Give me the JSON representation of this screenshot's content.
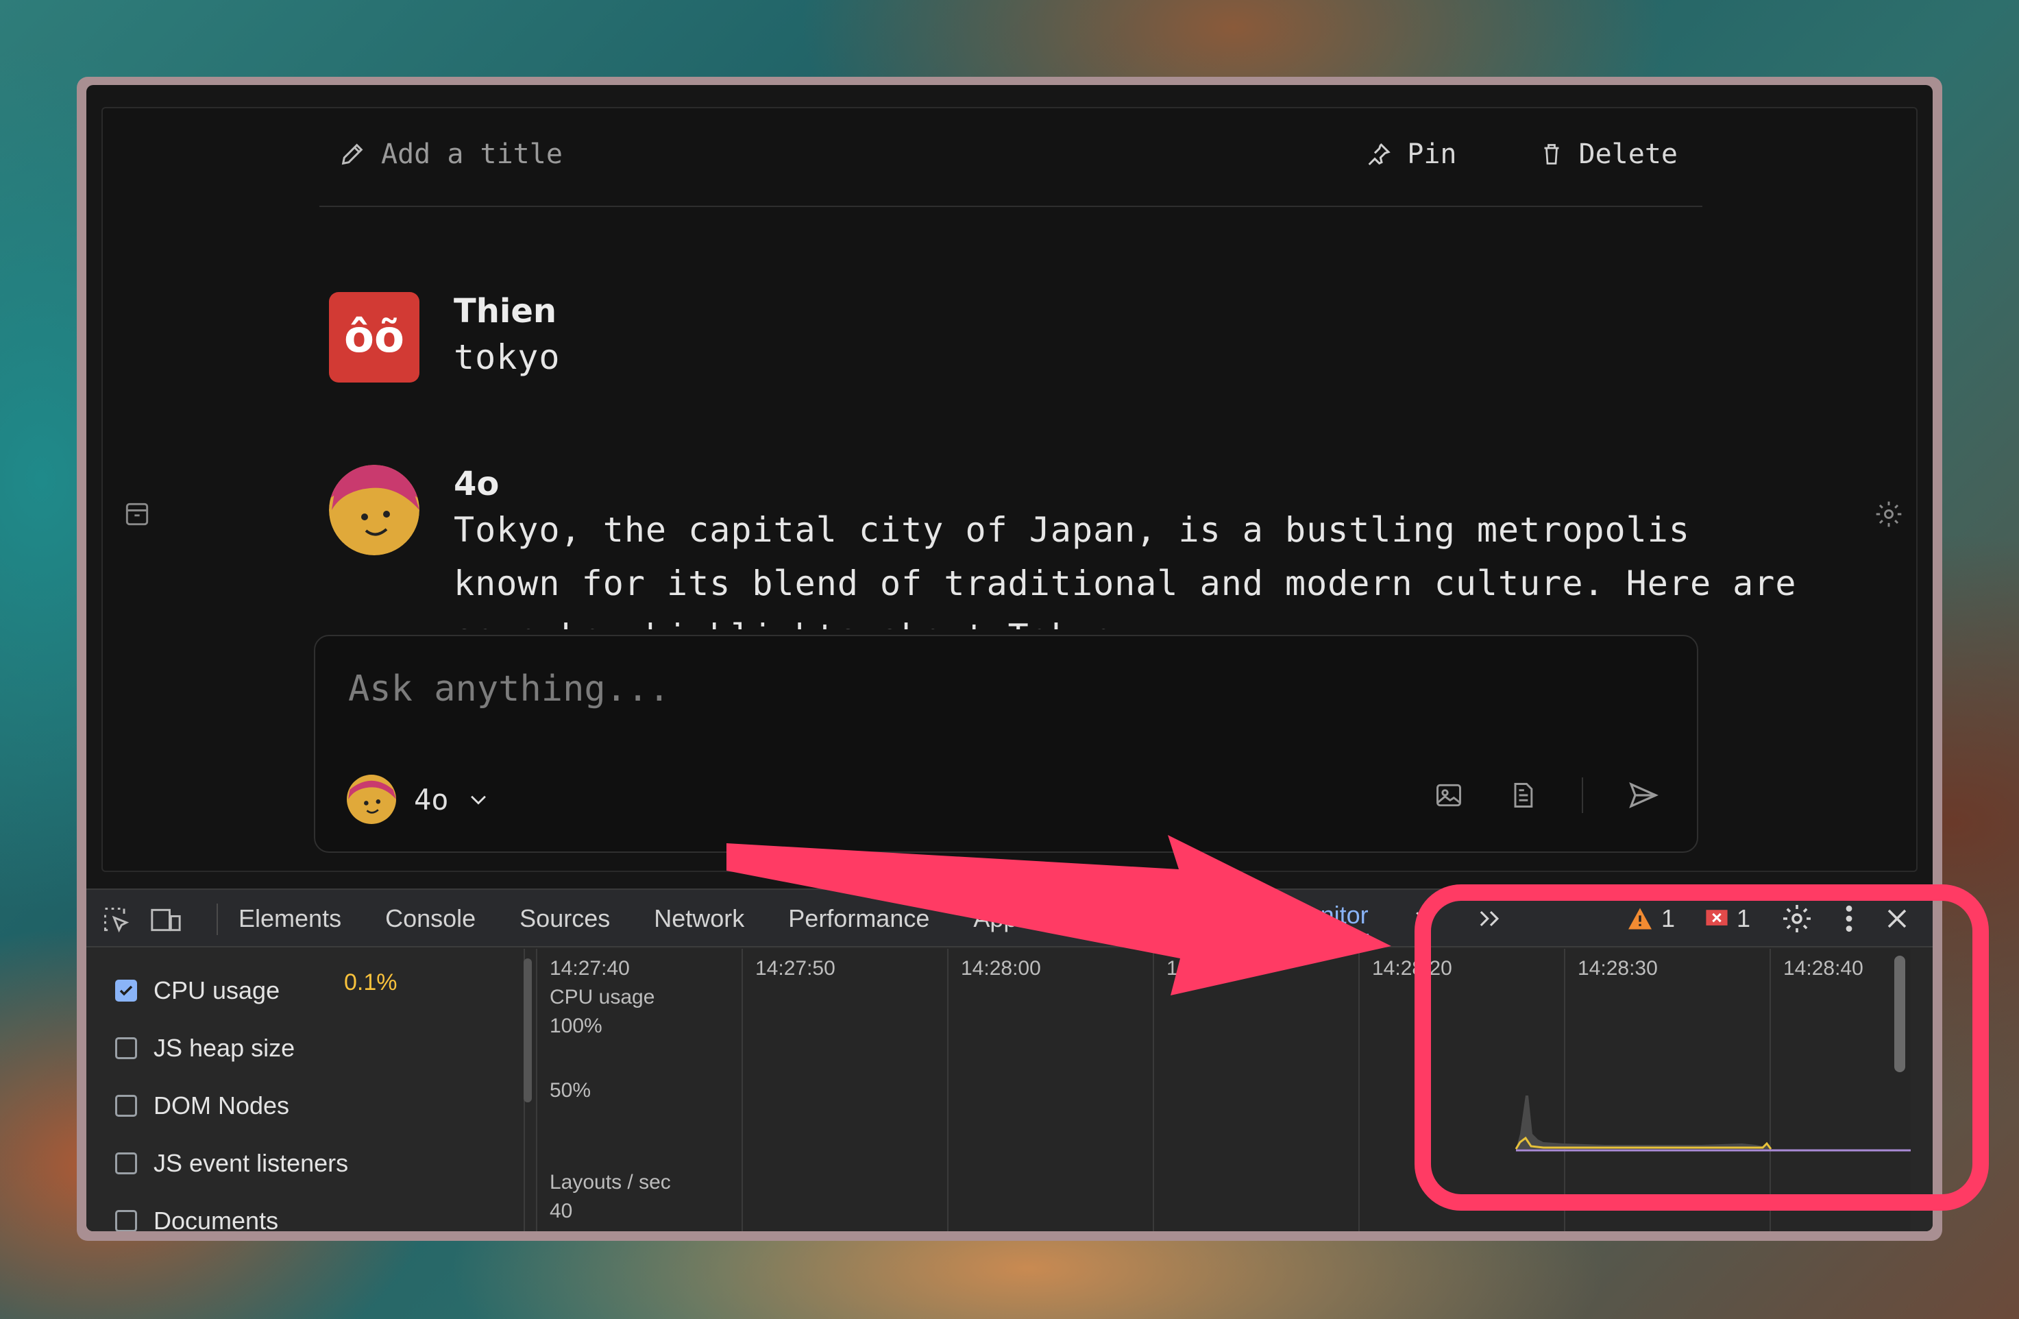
{
  "titlebar": {
    "add_title": "Add a title",
    "pin": "Pin",
    "delete": "Delete"
  },
  "messages": [
    {
      "name": "Thien",
      "avatar_text": "ôõ",
      "text": "tokyo"
    },
    {
      "name": "4o",
      "text_lines": [
        "Tokyo, the capital city of Japan, is a bustling metropolis",
        "known for its blend of traditional and modern culture. Here are",
        "some key highlights about Tokyo:"
      ]
    }
  ],
  "composer": {
    "placeholder": "Ask anything...",
    "model": "4o"
  },
  "devtools": {
    "tabs": [
      "Elements",
      "Console",
      "Sources",
      "Network",
      "Performance",
      "Application",
      "Performance monitor"
    ],
    "active_tab": "Performance monitor",
    "warnings": "1",
    "errors": "1",
    "metrics": [
      {
        "label": "CPU usage",
        "checked": true,
        "value": "0.1%"
      },
      {
        "label": "JS heap size",
        "checked": false
      },
      {
        "label": "DOM Nodes",
        "checked": false
      },
      {
        "label": "JS event listeners",
        "checked": false
      },
      {
        "label": "Documents",
        "checked": false
      }
    ],
    "times": [
      "14:27:40",
      "14:27:50",
      "14:28:00",
      "14:28:10",
      "14:28:20",
      "14:28:30",
      "14:28:40"
    ],
    "graph_cpu_label": "CPU usage",
    "graph_100": "100%",
    "graph_50": "50%",
    "graph_layouts_label": "Layouts / sec",
    "graph_layouts_value": "40"
  },
  "colors": {
    "annotation": "#ff3b64",
    "accent": "#8ab4f8",
    "cpu_value": "#f9c23c",
    "avatar_red": "#d23a34"
  }
}
